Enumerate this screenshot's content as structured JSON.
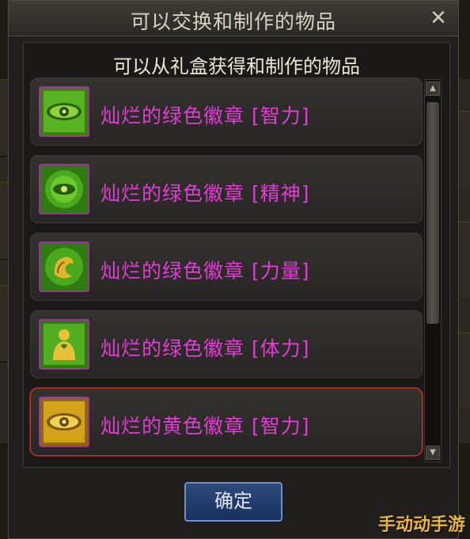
{
  "window": {
    "title": "可以交换和制作的物品",
    "close_glyph": "✕"
  },
  "panel": {
    "subtitle": "可以从礼盒获得和制作的物品"
  },
  "items": [
    {
      "label": "灿烂的绿色徽章 [智力]",
      "icon": "eye-emblem-icon",
      "color": "green"
    },
    {
      "label": "灿烂的绿色徽章 [精神]",
      "icon": "spirit-eye-emblem-icon",
      "color": "green"
    },
    {
      "label": "灿烂的绿色徽章 [力量]",
      "icon": "strength-emblem-icon",
      "color": "green"
    },
    {
      "label": "灿烂的绿色徽章 [体力]",
      "icon": "stamina-emblem-icon",
      "color": "green"
    },
    {
      "label": "灿烂的黄色徽章 [智力]",
      "icon": "eye-emblem-icon",
      "color": "yellow"
    }
  ],
  "confirm_label": "确定",
  "watermark": "手动动手游",
  "colors": {
    "item_text": "#e23cd6",
    "icon_border": "#a02fa0",
    "green_emblem": "#4fb31f",
    "yellow_emblem": "#d9a41a",
    "selected_border": "#c0392b"
  }
}
